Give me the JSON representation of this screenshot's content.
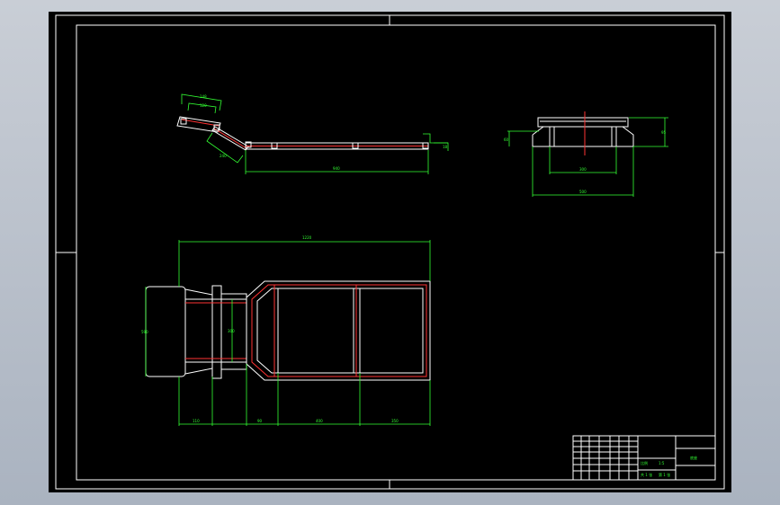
{
  "window": {
    "app": "CAD drawing viewer",
    "background_color": "#b9c1cd",
    "canvas_color": "#000000"
  },
  "colors": {
    "geometry": "#ffffff",
    "dimension": "#33ff33",
    "centerline": "#ff3333"
  },
  "drawing": {
    "side_view": {
      "dims": {
        "top_short": "148",
        "top_long": "120",
        "angled": "240",
        "length": "940",
        "height": "18"
      }
    },
    "end_view": {
      "dims": {
        "inner_width": "300",
        "outer_width": "500",
        "height_left": "60",
        "height_right": "95"
      }
    },
    "plan_view": {
      "dims": {
        "overall": "1220",
        "left_height": "590",
        "mid_height": "300",
        "seg1": "110",
        "seg2": "90",
        "seg3": "400",
        "seg4": "350"
      }
    },
    "title_block": {
      "title": "底座",
      "scale_label": "比例",
      "scale_value": "1:5",
      "sheet_text": "共 1 张",
      "page": "第 1 张"
    }
  }
}
